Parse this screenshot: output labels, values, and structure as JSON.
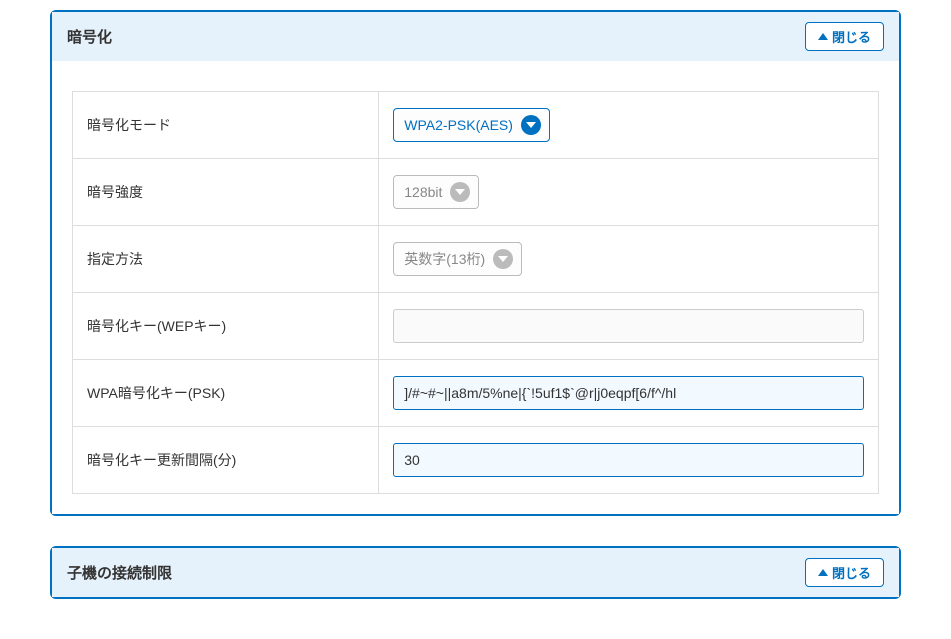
{
  "panel1": {
    "title": "暗号化",
    "close_label": "閉じる",
    "rows": {
      "mode": {
        "label": "暗号化モード",
        "value": "WPA2-PSK(AES)"
      },
      "strength": {
        "label": "暗号強度",
        "value": "128bit"
      },
      "method": {
        "label": "指定方法",
        "value": "英数字(13桁)"
      },
      "wepkey": {
        "label": "暗号化キー(WEPキー)",
        "value": ""
      },
      "psk": {
        "label": "WPA暗号化キー(PSK)",
        "value": "]/#~#~||a8m/5%ne|{`!5uf1$`@r|j0eqpf[6/f^/hl"
      },
      "interval": {
        "label": "暗号化キー更新間隔(分)",
        "value": "30"
      }
    }
  },
  "panel2": {
    "title": "子機の接続制限",
    "close_label": "閉じる"
  }
}
